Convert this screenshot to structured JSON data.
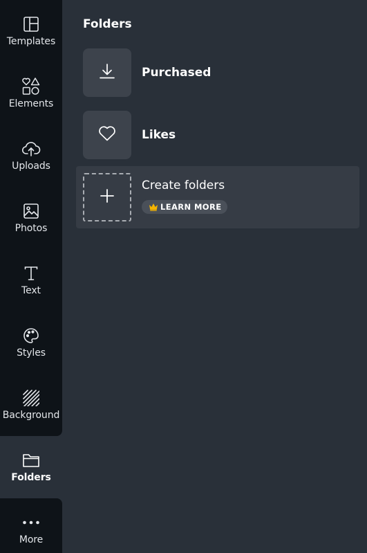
{
  "sidebar": {
    "items": [
      {
        "label": "Templates",
        "icon": "templates-icon"
      },
      {
        "label": "Elements",
        "icon": "elements-icon"
      },
      {
        "label": "Uploads",
        "icon": "upload-cloud-icon"
      },
      {
        "label": "Photos",
        "icon": "image-icon"
      },
      {
        "label": "Text",
        "icon": "text-icon"
      },
      {
        "label": "Styles",
        "icon": "palette-icon"
      },
      {
        "label": "Background",
        "icon": "stripes-icon"
      },
      {
        "label": "Folders",
        "icon": "folder-icon",
        "active": true
      },
      {
        "label": "More",
        "icon": "more-dots-icon"
      }
    ]
  },
  "panel": {
    "title": "Folders",
    "folders": [
      {
        "label": "Purchased",
        "icon": "download-icon"
      },
      {
        "label": "Likes",
        "icon": "heart-icon"
      }
    ],
    "create": {
      "label": "Create folders",
      "icon": "plus-icon",
      "badge_label": "LEARN MORE",
      "badge_icon": "crown-icon"
    }
  },
  "colors": {
    "rail_bg": "#0e1318",
    "panel_bg": "#293039",
    "tile_bg": "#3d434c",
    "create_row_bg": "#363c45",
    "crown": "#f5b400"
  }
}
